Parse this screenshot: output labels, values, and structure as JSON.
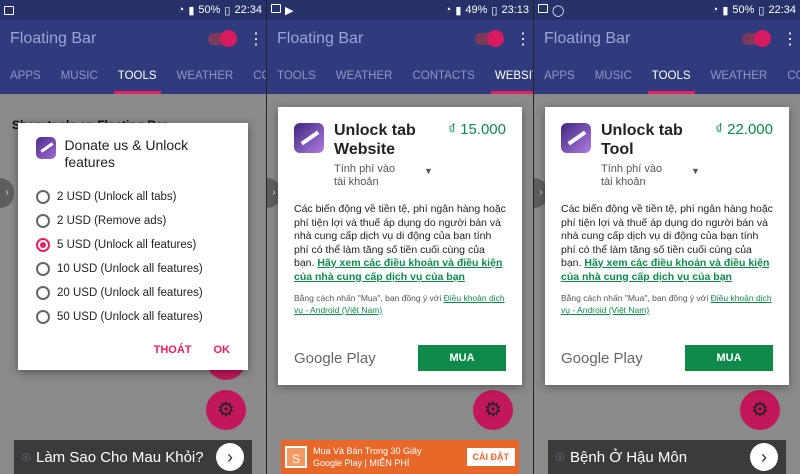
{
  "screens": [
    {
      "status": {
        "battery": "50%",
        "time": "22:34"
      },
      "app_title": "Floating Bar",
      "tabs": [
        "APPS",
        "MUSIC",
        "TOOLS",
        "WEATHER",
        "CONT"
      ],
      "active_tab": "TOOLS",
      "background_text": "Show tools on Floating Bar",
      "dialog": {
        "title": "Donate us & Unlock features",
        "options": [
          {
            "label": "2 USD (Unlock all tabs)",
            "checked": false
          },
          {
            "label": "2 USD (Remove ads)",
            "checked": false
          },
          {
            "label": "5 USD (Unlock all features)",
            "checked": true
          },
          {
            "label": "10 USD (Unlock all features)",
            "checked": false
          },
          {
            "label": "20 USD (Unlock all features)",
            "checked": false
          },
          {
            "label": "50 USD (Unlock all features)",
            "checked": false
          }
        ],
        "cancel": "THOÁT",
        "ok": "OK"
      },
      "ad": {
        "text": "Làm Sao Cho Mau Khỏi?",
        "arrow": "›"
      }
    },
    {
      "status": {
        "battery": "49%",
        "time": "23:13"
      },
      "app_title": "Floating Bar",
      "tabs": [
        "TOOLS",
        "WEATHER",
        "CONTACTS",
        "WEBSITES"
      ],
      "active_tab": "WEBSITES",
      "card": {
        "name": "Unlock tab Website",
        "price": "₫ 15.000",
        "billing": "Tính phí vào tài khoản",
        "body": "Các biến động về tiền tệ, phí ngân hàng hoặc phí tiện lợi và thuế áp dụng do người bán và nhà cung cấp dịch vụ di động của bạn tính phí có thể làm tăng số tiền cuối cùng của bạn.",
        "body_link": "Hãy xem các điều khoản và điều kiện của nhà cung cấp dịch vụ của bạn",
        "legal": "Bằng cách nhấn \"Mua\", bạn đồng ý với",
        "legal_link": "Điều khoản dịch vụ - Android (Việt Nam)",
        "brand": "Google Play",
        "buy": "MUA"
      },
      "ad": {
        "line1": "Mua Và Bán Trong 30 Giây",
        "line2": "Google Play | MIỄN PHÍ",
        "button": "CÀI ĐẶT",
        "logo": "S"
      }
    },
    {
      "status": {
        "battery": "50%",
        "time": "22:34"
      },
      "app_title": "Floating Bar",
      "tabs": [
        "APPS",
        "MUSIC",
        "TOOLS",
        "WEATHER",
        "CO"
      ],
      "active_tab": "TOOLS",
      "card": {
        "name": "Unlock tab Tool",
        "price": "₫ 22.000",
        "billing": "Tính phí vào tài khoản",
        "body": "Các biến động về tiền tệ, phí ngân hàng hoặc phí tiện lợi và thuế áp dụng do người bán và nhà cung cấp dịch vụ di động của bạn tính phí có thể làm tăng số tiền cuối cùng của bạn.",
        "body_link": "Hãy xem các điều khoản và điều kiện của nhà cung cấp dịch vụ của bạn",
        "legal": "Bằng cách nhấn \"Mua\", bạn đồng ý với",
        "legal_link": "Điều khoản dịch vụ - Android (Việt Nam)",
        "brand": "Google Play",
        "buy": "MUA"
      },
      "ad": {
        "text": "Bệnh Ở Hậu Môn",
        "arrow": "›"
      }
    }
  ]
}
